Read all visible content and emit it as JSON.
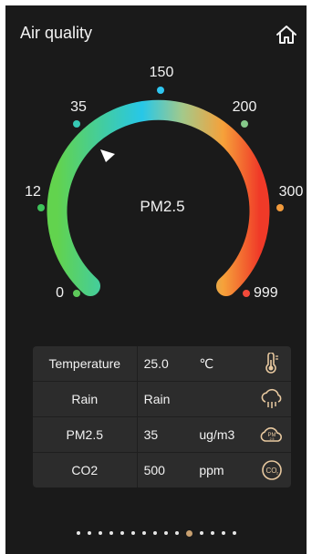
{
  "header": {
    "title": "Air quality",
    "home_icon": "home-icon"
  },
  "gauge": {
    "center_label": "PM2.5",
    "scale_labels": [
      "0",
      "12",
      "35",
      "150",
      "200",
      "300",
      "999"
    ],
    "marker_colors": [
      "#5ec95a",
      "#3ec25a",
      "#37c9b5",
      "#2fc6f0",
      "#86c98a",
      "#f29a3c",
      "#f24a3a"
    ],
    "arc_gradient": [
      "#62d34e",
      "#27c7e8",
      "#a4c98a",
      "#f6a13a",
      "#f03a28"
    ],
    "pointer_value": "35"
  },
  "table": {
    "rows": [
      {
        "label": "Temperature",
        "value": "25.0",
        "unit": "℃",
        "icon": "thermometer-icon"
      },
      {
        "label": "Rain",
        "value": "Rain",
        "unit": "",
        "icon": "cloud-rain-icon"
      },
      {
        "label": "PM2.5",
        "value": "35",
        "unit": "ug/m3",
        "icon": "pm25-cloud-icon"
      },
      {
        "label": "CO2",
        "value": "500",
        "unit": "ppm",
        "icon": "co2-icon"
      }
    ]
  },
  "pager": {
    "count": 15,
    "active_index": 10
  },
  "colors": {
    "background": "#1a1a1a",
    "icon_accent": "#e8c9a0",
    "active_dot": "#c8a070"
  }
}
